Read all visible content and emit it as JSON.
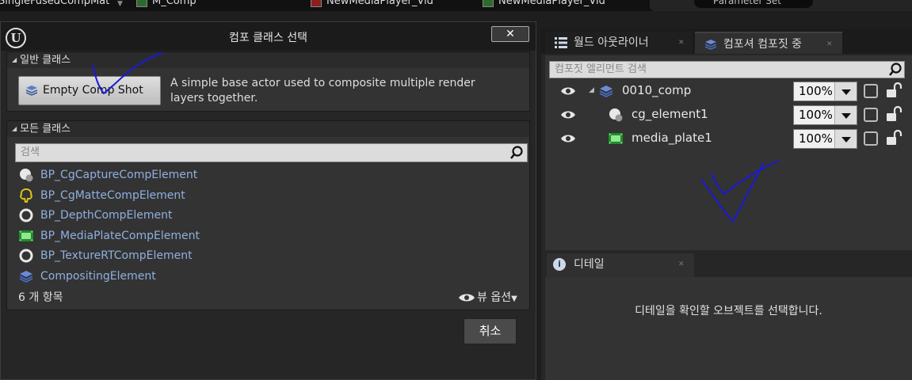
{
  "top_strip": {
    "tabs": [
      "SingleFusedCompMat",
      "M_Comp",
      "NewMediaPlayer_Vid",
      "NewMediaPlayer_Vid"
    ],
    "right_pill": "Parameter Set"
  },
  "dialog": {
    "logo": "U",
    "title": "컴포 클래스 선택",
    "close_label": "✕",
    "common_section": {
      "header": "일반 클래스",
      "button_label": "Empty Comp Shot",
      "description": "A simple base actor used to composite multiple render layers together."
    },
    "all_section": {
      "header": "모든 클래스",
      "search_placeholder": "검색",
      "items": [
        {
          "label": "BP_CgCaptureCompElement",
          "icon": "cg-capture-icon"
        },
        {
          "label": "BP_CgMatteCompElement",
          "icon": "cg-matte-icon"
        },
        {
          "label": "BP_DepthCompElement",
          "icon": "ring-icon"
        },
        {
          "label": "BP_MediaPlateCompElement",
          "icon": "media-plate-icon"
        },
        {
          "label": "BP_TextureRTCompElement",
          "icon": "ring-icon"
        },
        {
          "label": "CompositingElement",
          "icon": "layers-icon"
        }
      ],
      "item_count": "6 개 항목",
      "view_options": "뷰 옵션"
    },
    "cancel_label": "취소"
  },
  "right_panel": {
    "tabs": [
      {
        "label": "월드 아웃라이너",
        "icon": "outliner-icon",
        "active": false
      },
      {
        "label": "컴포셔 컴포짓 중",
        "icon": "layers-icon",
        "active": true
      }
    ],
    "outliner": {
      "search_placeholder": "컴포짓 엘리먼트 검색",
      "rows": [
        {
          "label": "0010_comp",
          "icon": "layers-icon",
          "opacity": "100%",
          "depth": 0
        },
        {
          "label": "cg_element1",
          "icon": "cg-capture-icon",
          "opacity": "100%",
          "depth": 1
        },
        {
          "label": "media_plate1",
          "icon": "media-plate-icon",
          "opacity": "100%",
          "depth": 1
        }
      ]
    },
    "details": {
      "tab_label": "디테일",
      "empty_message": "디테일을 확인할 오브젝트를 선택합니다."
    }
  },
  "colors": {
    "link_text": "#8fb0e0",
    "annotation_ink": "#1a1ad6"
  }
}
